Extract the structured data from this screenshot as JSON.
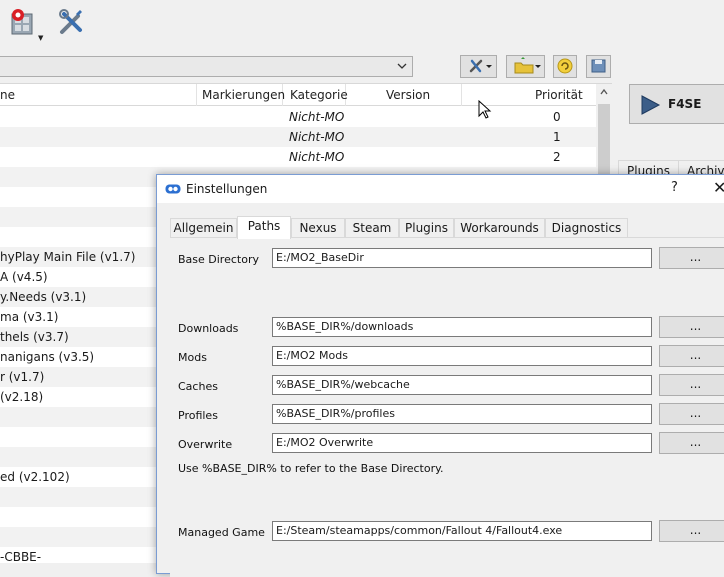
{
  "toolbar": {
    "icons": [
      "executables-icon",
      "tools-icon"
    ]
  },
  "profile_combo": {
    "value": ""
  },
  "modlist": {
    "columns": [
      {
        "label": "ne"
      },
      {
        "label": "Markierungen"
      },
      {
        "label": "Kategorie"
      },
      {
        "label": "Version"
      },
      {
        "label": "Priorität"
      }
    ],
    "rows": [
      {
        "name": "",
        "kategorie": "Nicht-MO",
        "prio": "0"
      },
      {
        "name": "",
        "kategorie": "Nicht-MO",
        "prio": "1"
      },
      {
        "name": "",
        "kategorie": "Nicht-MO",
        "prio": "2"
      },
      {
        "name": "",
        "kategorie": "",
        "prio": ""
      },
      {
        "name": "",
        "kategorie": "",
        "prio": ""
      },
      {
        "name": "",
        "kategorie": "",
        "prio": ""
      },
      {
        "name": "",
        "kategorie": "",
        "prio": ""
      },
      {
        "name": "hyPlay Main File (v1.7)",
        "kategorie": "",
        "prio": ""
      },
      {
        "name": "A (v4.5)",
        "kategorie": "",
        "prio": ""
      },
      {
        "name": "y.Needs (v3.1)",
        "kategorie": "",
        "prio": ""
      },
      {
        "name": "ma (v3.1)",
        "kategorie": "",
        "prio": ""
      },
      {
        "name": "thels (v3.7)",
        "kategorie": "",
        "prio": ""
      },
      {
        "name": "nanigans (v3.5)",
        "kategorie": "",
        "prio": ""
      },
      {
        "name": "r (v1.7)",
        "kategorie": "",
        "prio": ""
      },
      {
        "name": "(v2.18)",
        "kategorie": "",
        "prio": ""
      },
      {
        "name": "",
        "kategorie": "",
        "prio": ""
      },
      {
        "name": "",
        "kategorie": "",
        "prio": ""
      },
      {
        "name": "",
        "kategorie": "",
        "prio": ""
      },
      {
        "name": "ed (v2.102)",
        "kategorie": "",
        "prio": ""
      },
      {
        "name": "",
        "kategorie": "",
        "prio": ""
      },
      {
        "name": "",
        "kategorie": "",
        "prio": ""
      },
      {
        "name": "",
        "kategorie": "",
        "prio": ""
      },
      {
        "name": "-CBBE-",
        "kategorie": "",
        "prio": ""
      }
    ]
  },
  "right_panel": {
    "run_label": "F4SE",
    "tabs": [
      "Plugins",
      "Archive"
    ]
  },
  "dialog": {
    "title": "Einstellungen",
    "help": "?",
    "close": "✕",
    "tabs": [
      "Allgemein",
      "Paths",
      "Nexus",
      "Steam",
      "Plugins",
      "Workarounds",
      "Diagnostics"
    ],
    "active_tab": "Paths",
    "browse_label": "...",
    "fields": {
      "base_directory": {
        "label": "Base Directory",
        "value": "E:/MO2_BaseDir"
      },
      "downloads": {
        "label": "Downloads",
        "value": "%BASE_DIR%/downloads"
      },
      "mods": {
        "label": "Mods",
        "value": "E:/MO2 Mods"
      },
      "caches": {
        "label": "Caches",
        "value": "%BASE_DIR%/webcache"
      },
      "profiles": {
        "label": "Profiles",
        "value": "%BASE_DIR%/profiles"
      },
      "overwrite": {
        "label": "Overwrite",
        "value": "E:/MO2 Overwrite"
      },
      "managed_game": {
        "label": "Managed Game",
        "value": "E:/Steam/steamapps/common/Fallout 4/Fallout4.exe"
      }
    },
    "hint": "Use %BASE_DIR% to refer to the Base Directory."
  },
  "colors": {
    "window_bg": "#f0f0f0",
    "dialog_border": "#7a9cd3",
    "field_border": "#7a7a7a",
    "button_bg": "#e1e1e1"
  }
}
